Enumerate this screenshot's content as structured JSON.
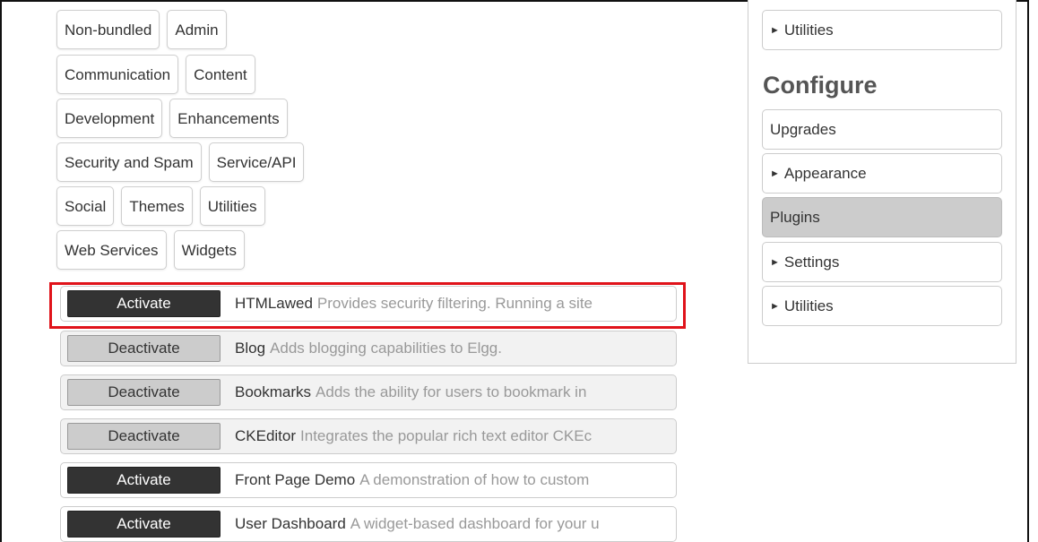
{
  "categories": {
    "rows": [
      [
        "Non-bundled",
        "Admin"
      ],
      [
        "Communication",
        "Content"
      ],
      [
        "Development",
        "Enhancements"
      ],
      [
        "Security and Spam",
        "Service/API"
      ],
      [
        "Social",
        "Themes",
        "Utilities"
      ],
      [
        "Web Services",
        "Widgets"
      ]
    ]
  },
  "plugins": [
    {
      "button": "Activate",
      "name": "HTMLawed",
      "description": "Provides security filtering. Running a site"
    },
    {
      "button": "Deactivate",
      "name": "Blog",
      "description": "Adds blogging capabilities to Elgg."
    },
    {
      "button": "Deactivate",
      "name": "Bookmarks",
      "description": "Adds the ability for users to bookmark in"
    },
    {
      "button": "Deactivate",
      "name": "CKEditor",
      "description": "Integrates the popular rich text editor CKEc"
    },
    {
      "button": "Activate",
      "name": "Front Page Demo",
      "description": "A demonstration of how to custom"
    },
    {
      "button": "Activate",
      "name": "User Dashboard",
      "description": "A widget-based dashboard for your u"
    }
  ],
  "sidebar": {
    "top_item": "Utilities",
    "heading": "Configure",
    "items": [
      {
        "label": "Upgrades",
        "arrow": false,
        "selected": false
      },
      {
        "label": "Appearance",
        "arrow": true,
        "selected": false
      },
      {
        "label": "Plugins",
        "arrow": false,
        "selected": true
      },
      {
        "label": "Settings",
        "arrow": true,
        "selected": false
      },
      {
        "label": "Utilities",
        "arrow": true,
        "selected": false
      }
    ]
  },
  "icons": {
    "expand_arrow": "triangle-right-icon"
  },
  "colors": {
    "highlight": "#e0131a",
    "activate_button": "#333333",
    "deactivate_button": "#cccccc"
  }
}
